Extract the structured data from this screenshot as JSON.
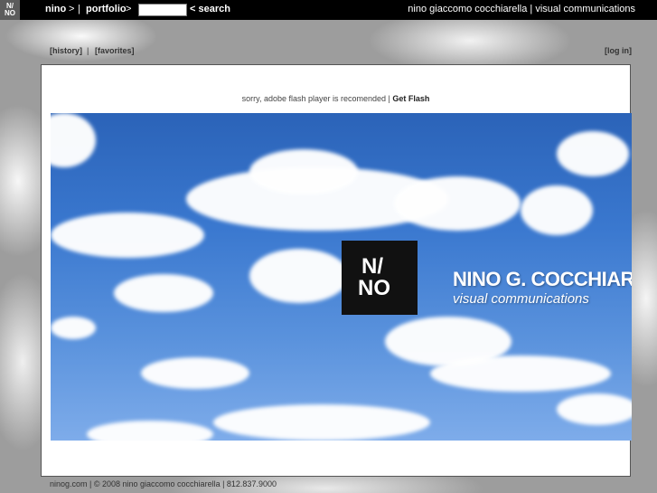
{
  "topbar": {
    "logo_line1": "N/",
    "logo_line2": "NO",
    "nav": [
      "nino",
      ">",
      "|",
      "portfolio",
      ">"
    ],
    "search_value": "",
    "search_label": "< search",
    "site_title": "nino giaccomo cocchiarella | visual communications"
  },
  "sublinks": {
    "history": "[history]",
    "sep": "|",
    "favorites": "[favorites]",
    "login": "[log in]"
  },
  "panel": {
    "flash_message": "sorry, adobe flash player is recomended | ",
    "get_flash": "Get Flash",
    "banner": {
      "logo_line1": "N/",
      "logo_line2": "NO",
      "name": "NINO G. COCCHIARELLA",
      "subtitle": "visual communications"
    }
  },
  "footer": {
    "text": "ninog.com | © 2008 nino giaccomo cocchiarella | 812.837.9000"
  },
  "colors": {
    "topbar_bg": "#000000",
    "sky_blue": "#3a78cf"
  }
}
